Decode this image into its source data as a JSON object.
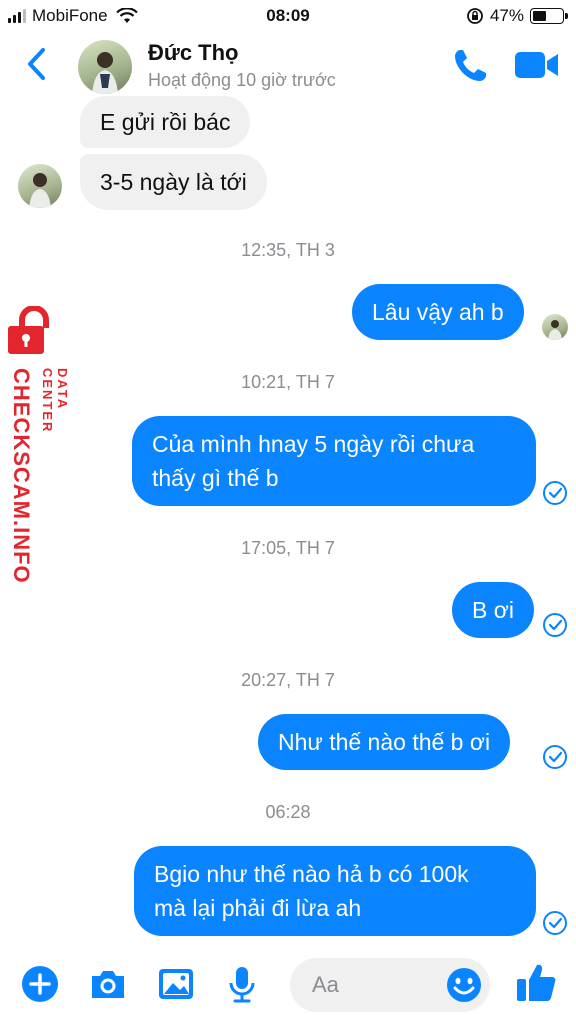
{
  "status_bar": {
    "carrier": "MobiFone",
    "time": "08:09",
    "battery_percent": "47%",
    "battery_level": 0.47
  },
  "header": {
    "contact_name": "Đức Thọ",
    "activity": "Hoạt động 10 giờ trước",
    "icons": [
      "back-chevron-icon",
      "phone-icon",
      "video-camera-icon"
    ]
  },
  "messages": {
    "m1": "E gửi rồi bác",
    "m2": "3-5 ngày là tới",
    "ts1": "12:35, TH 3",
    "m3": "Lâu vậy ah b",
    "ts2": "10:21, TH 7",
    "m4_line1": "Của mình hnay 5 ngày rồi chưa",
    "m4_line2": "thấy gì thế b",
    "ts3": "17:05, TH 7",
    "m5": "B ơi",
    "ts4": "20:27, TH 7",
    "m6": "Như thế nào thế b ơi",
    "ts5": "06:28",
    "m7_line1": "Bgio như thế nào hả b có 100k",
    "m7_line2": "mà lại phải đi lừa ah"
  },
  "watermark": {
    "main": "CHECKSCAM.INFO",
    "sub": "DATA CENTER",
    "color": "#e3262d"
  },
  "composer": {
    "placeholder": "Aa",
    "icons": [
      "plus-icon",
      "camera-icon",
      "gallery-icon",
      "microphone-icon",
      "emoji-icon",
      "thumbs-up-icon"
    ]
  },
  "colors": {
    "accent": "#0a84ff",
    "incoming_bubble": "#f0f0f0",
    "timestamp": "#8a8d91"
  }
}
